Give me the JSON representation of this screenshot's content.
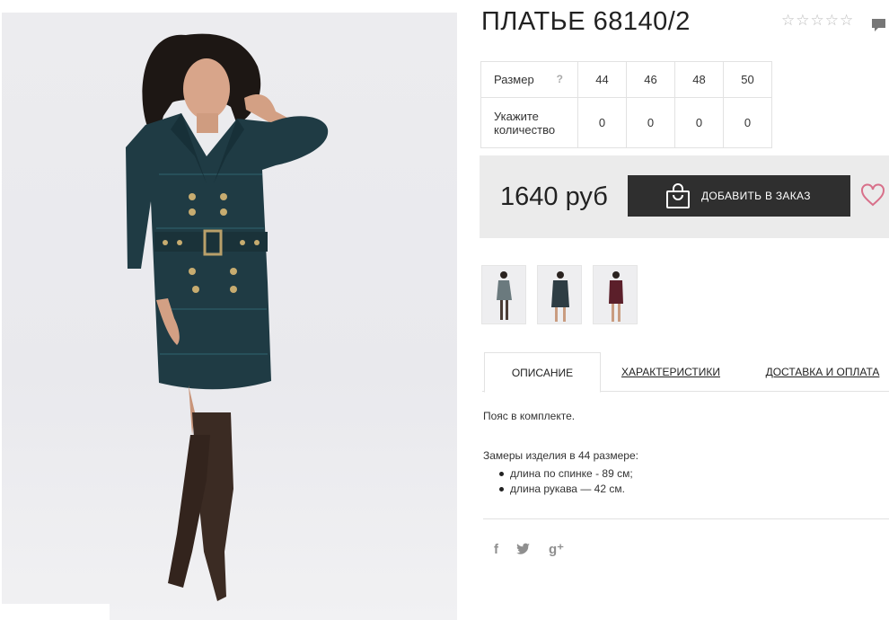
{
  "product": {
    "title": "ПЛАТЬЕ 68140/2",
    "rating_stars": [
      "☆",
      "☆",
      "☆",
      "☆",
      "☆"
    ],
    "photo_icon": "model-in-dress-photo"
  },
  "sizes": {
    "size_label": "Размер",
    "help": "?",
    "qty_label": "Укажите количество",
    "columns": [
      "44",
      "46",
      "48",
      "50"
    ],
    "quantities": [
      "0",
      "0",
      "0",
      "0"
    ]
  },
  "buy": {
    "price": "1640 руб",
    "add_label": "ДОБАВИТЬ В ЗАКАЗ",
    "colors": {
      "button": "#2f2f2f",
      "heart": "#d8708a",
      "panel": "#ebebeb"
    }
  },
  "tabs": [
    {
      "label": "ОПИСАНИЕ"
    },
    {
      "label": "ХАРАКТЕРИСТИКИ"
    },
    {
      "label": "ДОСТАВКА И ОПЛАТА"
    }
  ],
  "description": {
    "intro": "Пояс в комплекте.",
    "measures_title": "Замеры изделия в 44 размере:",
    "items": [
      "длина по спинке - 89 см;",
      "длина рукава — 42 см."
    ]
  },
  "social": {
    "facebook": "f",
    "twitter": "twitter-icon",
    "google": "g⁺"
  }
}
